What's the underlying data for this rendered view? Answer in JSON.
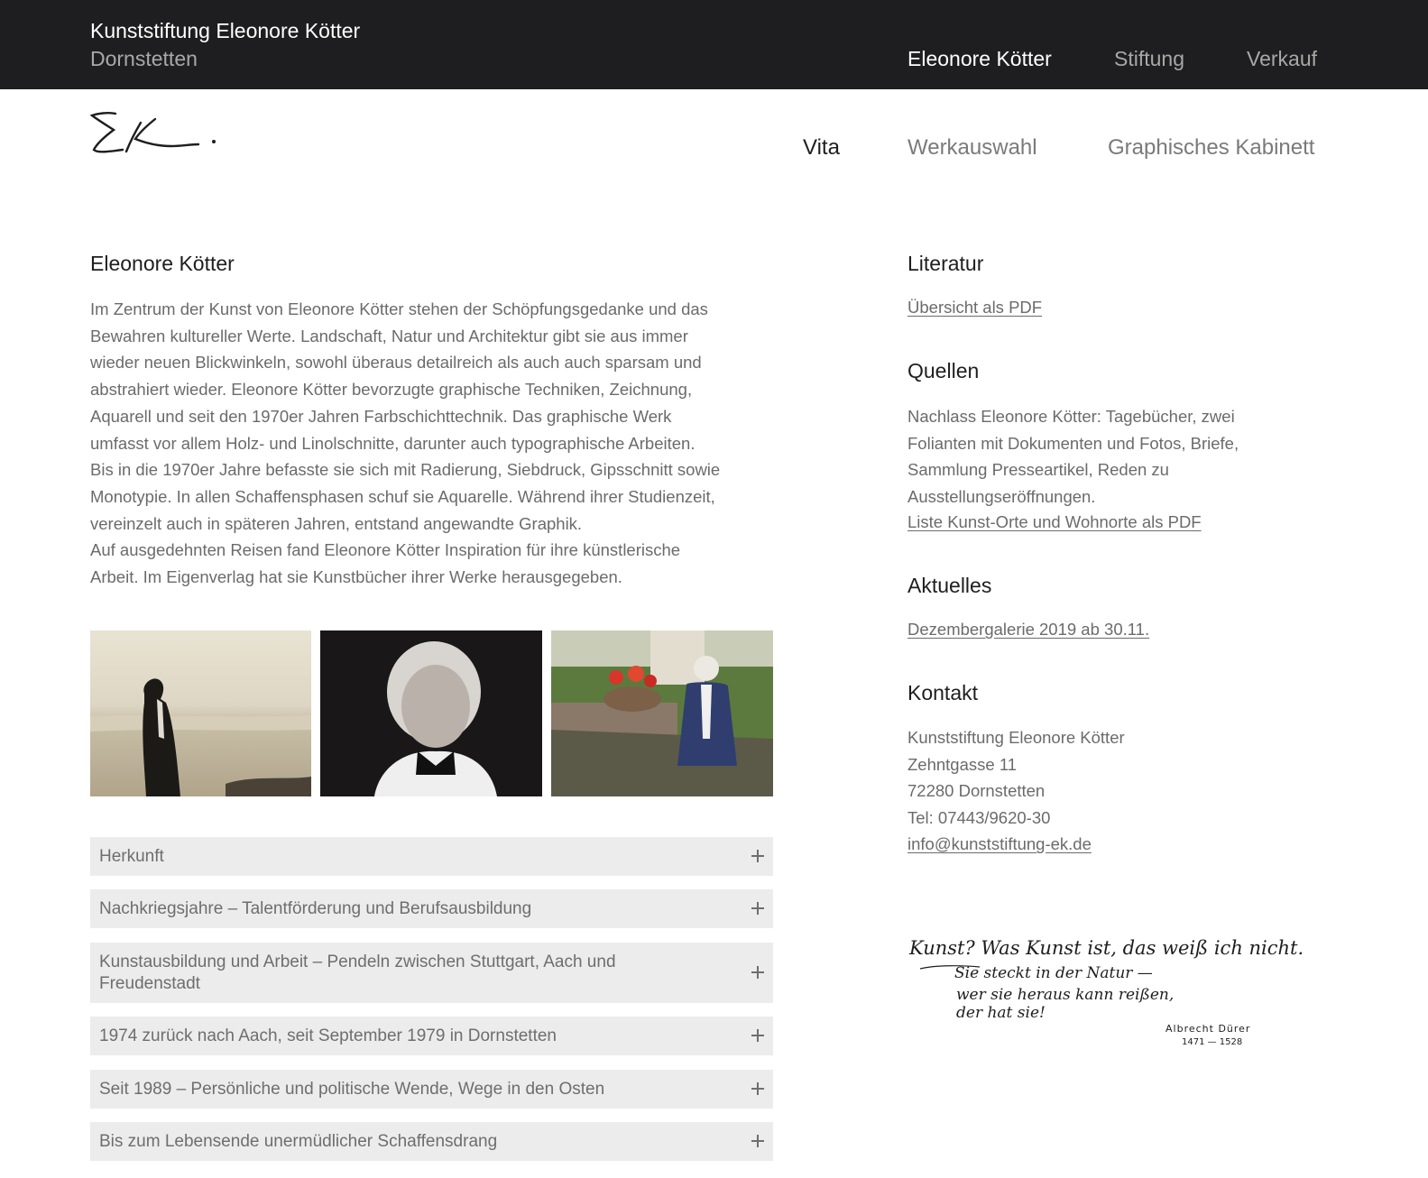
{
  "header": {
    "brand_title": "Kunststiftung Eleonore Kötter",
    "brand_subtitle": "Dornstetten",
    "nav": [
      {
        "label": "Eleonore Kötter",
        "active": true
      },
      {
        "label": "Stiftung",
        "active": false
      },
      {
        "label": "Verkauf",
        "active": false
      }
    ]
  },
  "subheader": {
    "logo_icon": "signature-ek-logo",
    "nav": [
      {
        "label": "Vita",
        "active": true
      },
      {
        "label": "Werkauswahl",
        "active": false
      },
      {
        "label": "Graphisches Kabinett",
        "active": false
      }
    ]
  },
  "main": {
    "title": "Eleonore Kötter",
    "intro_lines": [
      "Im Zentrum der Kunst von Eleonore Kötter stehen der Schöpfungsgedanke und das",
      "Bewahren kultureller Werte. Landschaft, Natur und Architektur gibt sie aus immer",
      "wieder neuen Blickwinkeln, sowohl überaus detailreich als auch auch sparsam und",
      "abstrahiert wieder. Eleonore Kötter bevorzugte graphische Techniken, Zeichnung,",
      "Aquarell und seit den 1970er Jahren Farbschichttechnik. Das graphische Werk",
      "umfasst vor allem Holz- und Linolschnitte, darunter auch typographische Arbeiten.",
      "Bis in die 1970er Jahre befasste sie sich mit Radierung, Siebdruck, Gipsschnitt sowie",
      "Monotypie. In allen Schaffensphasen schuf sie Aquarelle. Während ihrer Studienzeit,",
      "vereinzelt auch in späteren Jahren, entstand angewandte Graphik.",
      "Auf ausgedehnten Reisen fand Eleonore Kötter Inspiration für ihre künstlerische",
      "Arbeit. Im Eigenverlag hat sie Kunstbücher ihrer Werke herausgegeben."
    ],
    "accordion": [
      {
        "label": "Herkunft"
      },
      {
        "label": "Nachkriegsjahre – Talentförderung und Berufsausbildung"
      },
      {
        "label_line1": "Kunstausbildung und Arbeit – Pendeln zwischen Stuttgart, Aach und",
        "label_line2": "Freudenstadt"
      },
      {
        "label": "1974 zurück nach Aach, seit September 1979 in Dornstetten"
      },
      {
        "label": "Seit 1989 – Persönliche und politische Wende, Wege in den Osten"
      },
      {
        "label": "Bis zum Lebensende unermüdlicher Schaffensdrang"
      }
    ]
  },
  "sidebar": {
    "literatur": {
      "heading": "Literatur",
      "link": "Übersicht als PDF"
    },
    "quellen": {
      "heading": "Quellen",
      "lines": [
        "Nachlass Eleonore Kötter: Tagebücher, zwei",
        "Folianten mit Dokumenten und Fotos, Briefe,",
        "Sammlung Presseartikel, Reden zu",
        "Ausstellungseröffnungen."
      ],
      "link": "Liste Kunst-Orte und Wohnorte als PDF"
    },
    "aktuelles": {
      "heading": "Aktuelles",
      "link": "Dezembergalerie 2019 ab 30.11."
    },
    "kontakt": {
      "heading": "Kontakt",
      "lines": [
        "Kunststiftung Eleonore Kötter",
        "Zehntgasse 11",
        "72280 Dornstetten",
        "Tel: 07443/9620-30"
      ],
      "email": "info@kunststiftung-ek.de"
    },
    "quote_handwritten": {
      "line1": "Kunst? Was Kunst ist, das weiß ich nicht.",
      "line2": "Sie steckt in der Natur —",
      "line3": "wer sie heraus kann reißen,",
      "line4": "der hat sie!",
      "author": "Albrecht Dürer",
      "years": "1471 — 1528"
    }
  }
}
